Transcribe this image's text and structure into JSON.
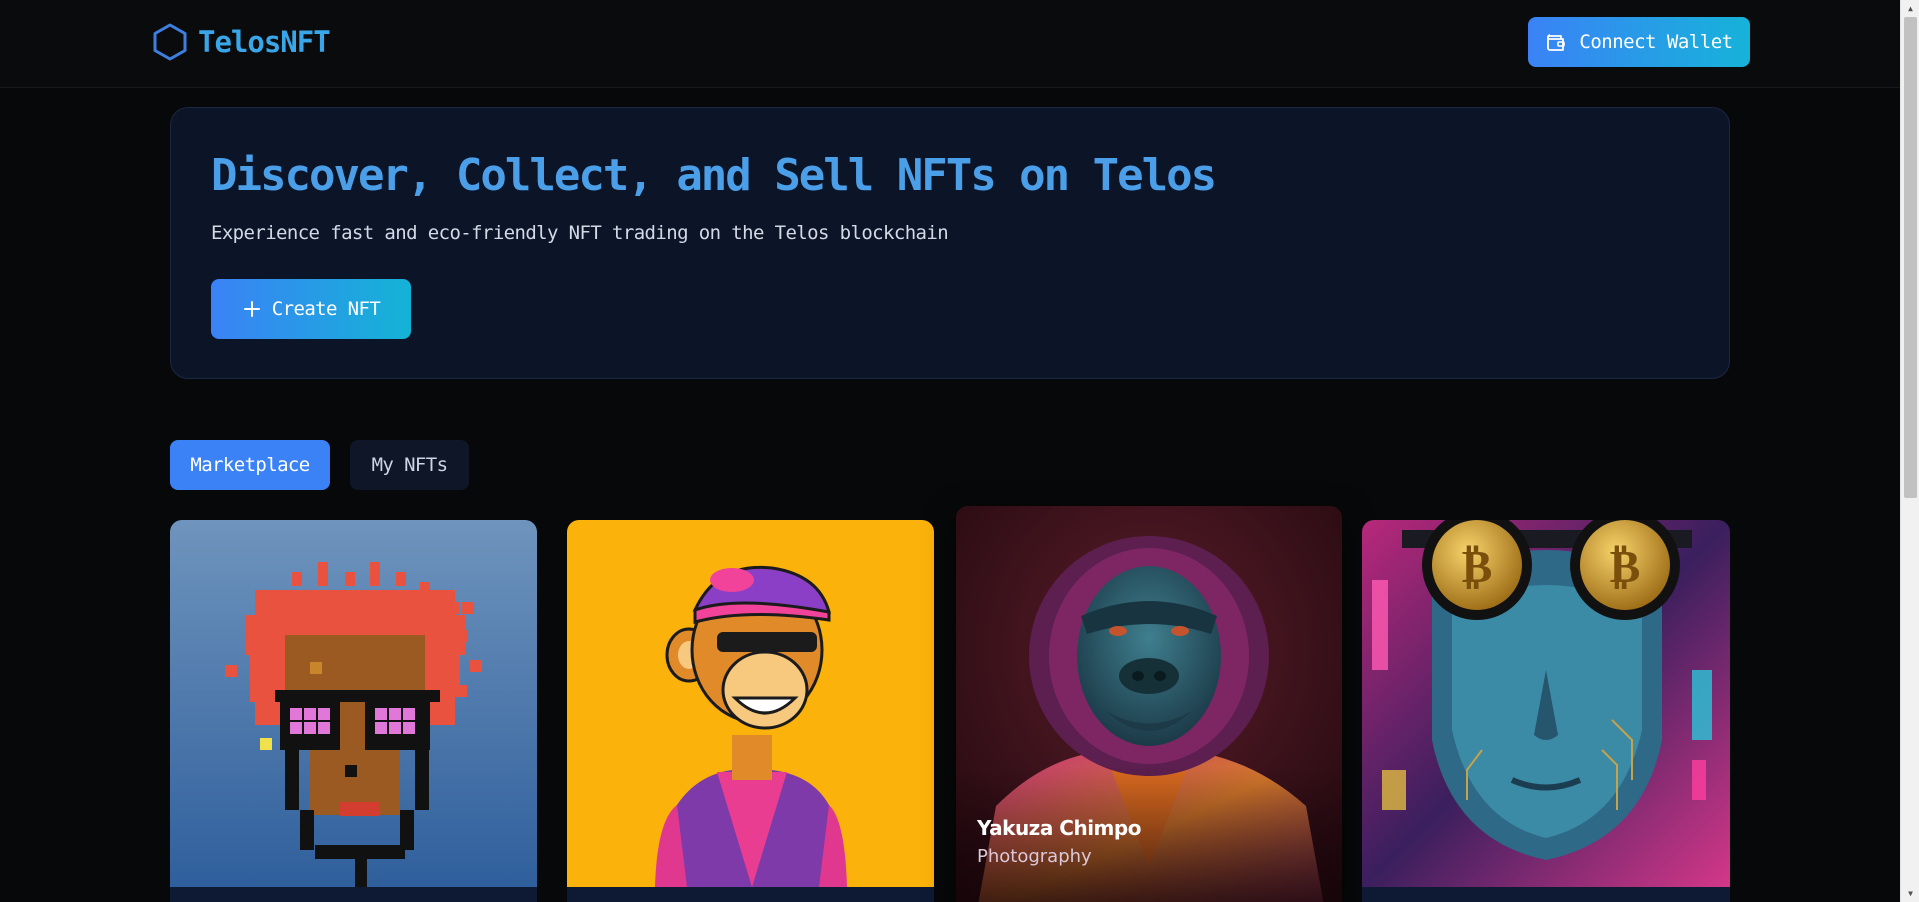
{
  "header": {
    "logo_text": "TelosNFT",
    "logo_icon": "hexagon-icon",
    "connect_label": "Connect Wallet",
    "connect_icon": "wallet-icon"
  },
  "hero": {
    "title": "Discover, Collect, and Sell NFTs on Telos",
    "subtitle": "Experience fast and eco-friendly NFT trading on the Telos blockchain",
    "create_label": "Create NFT",
    "create_icon": "plus-icon"
  },
  "tabs": [
    {
      "label": "Marketplace",
      "active": true
    },
    {
      "label": "My NFTs",
      "active": false
    }
  ],
  "cards": [
    {
      "art": "pixel-punk-art"
    },
    {
      "art": "cartoon-ape-art"
    },
    {
      "art": "gorilla-portrait-art",
      "name": "Yakuza Chimpo",
      "category": "Photography"
    },
    {
      "art": "cyberpunk-bitcoin-art"
    }
  ],
  "colors": {
    "accent": "#3b82f6",
    "accent_cyan": "#14b3d6",
    "title_blue": "#4b9fe8",
    "hero_bg": "#0c1428",
    "page_bg": "#070809"
  }
}
